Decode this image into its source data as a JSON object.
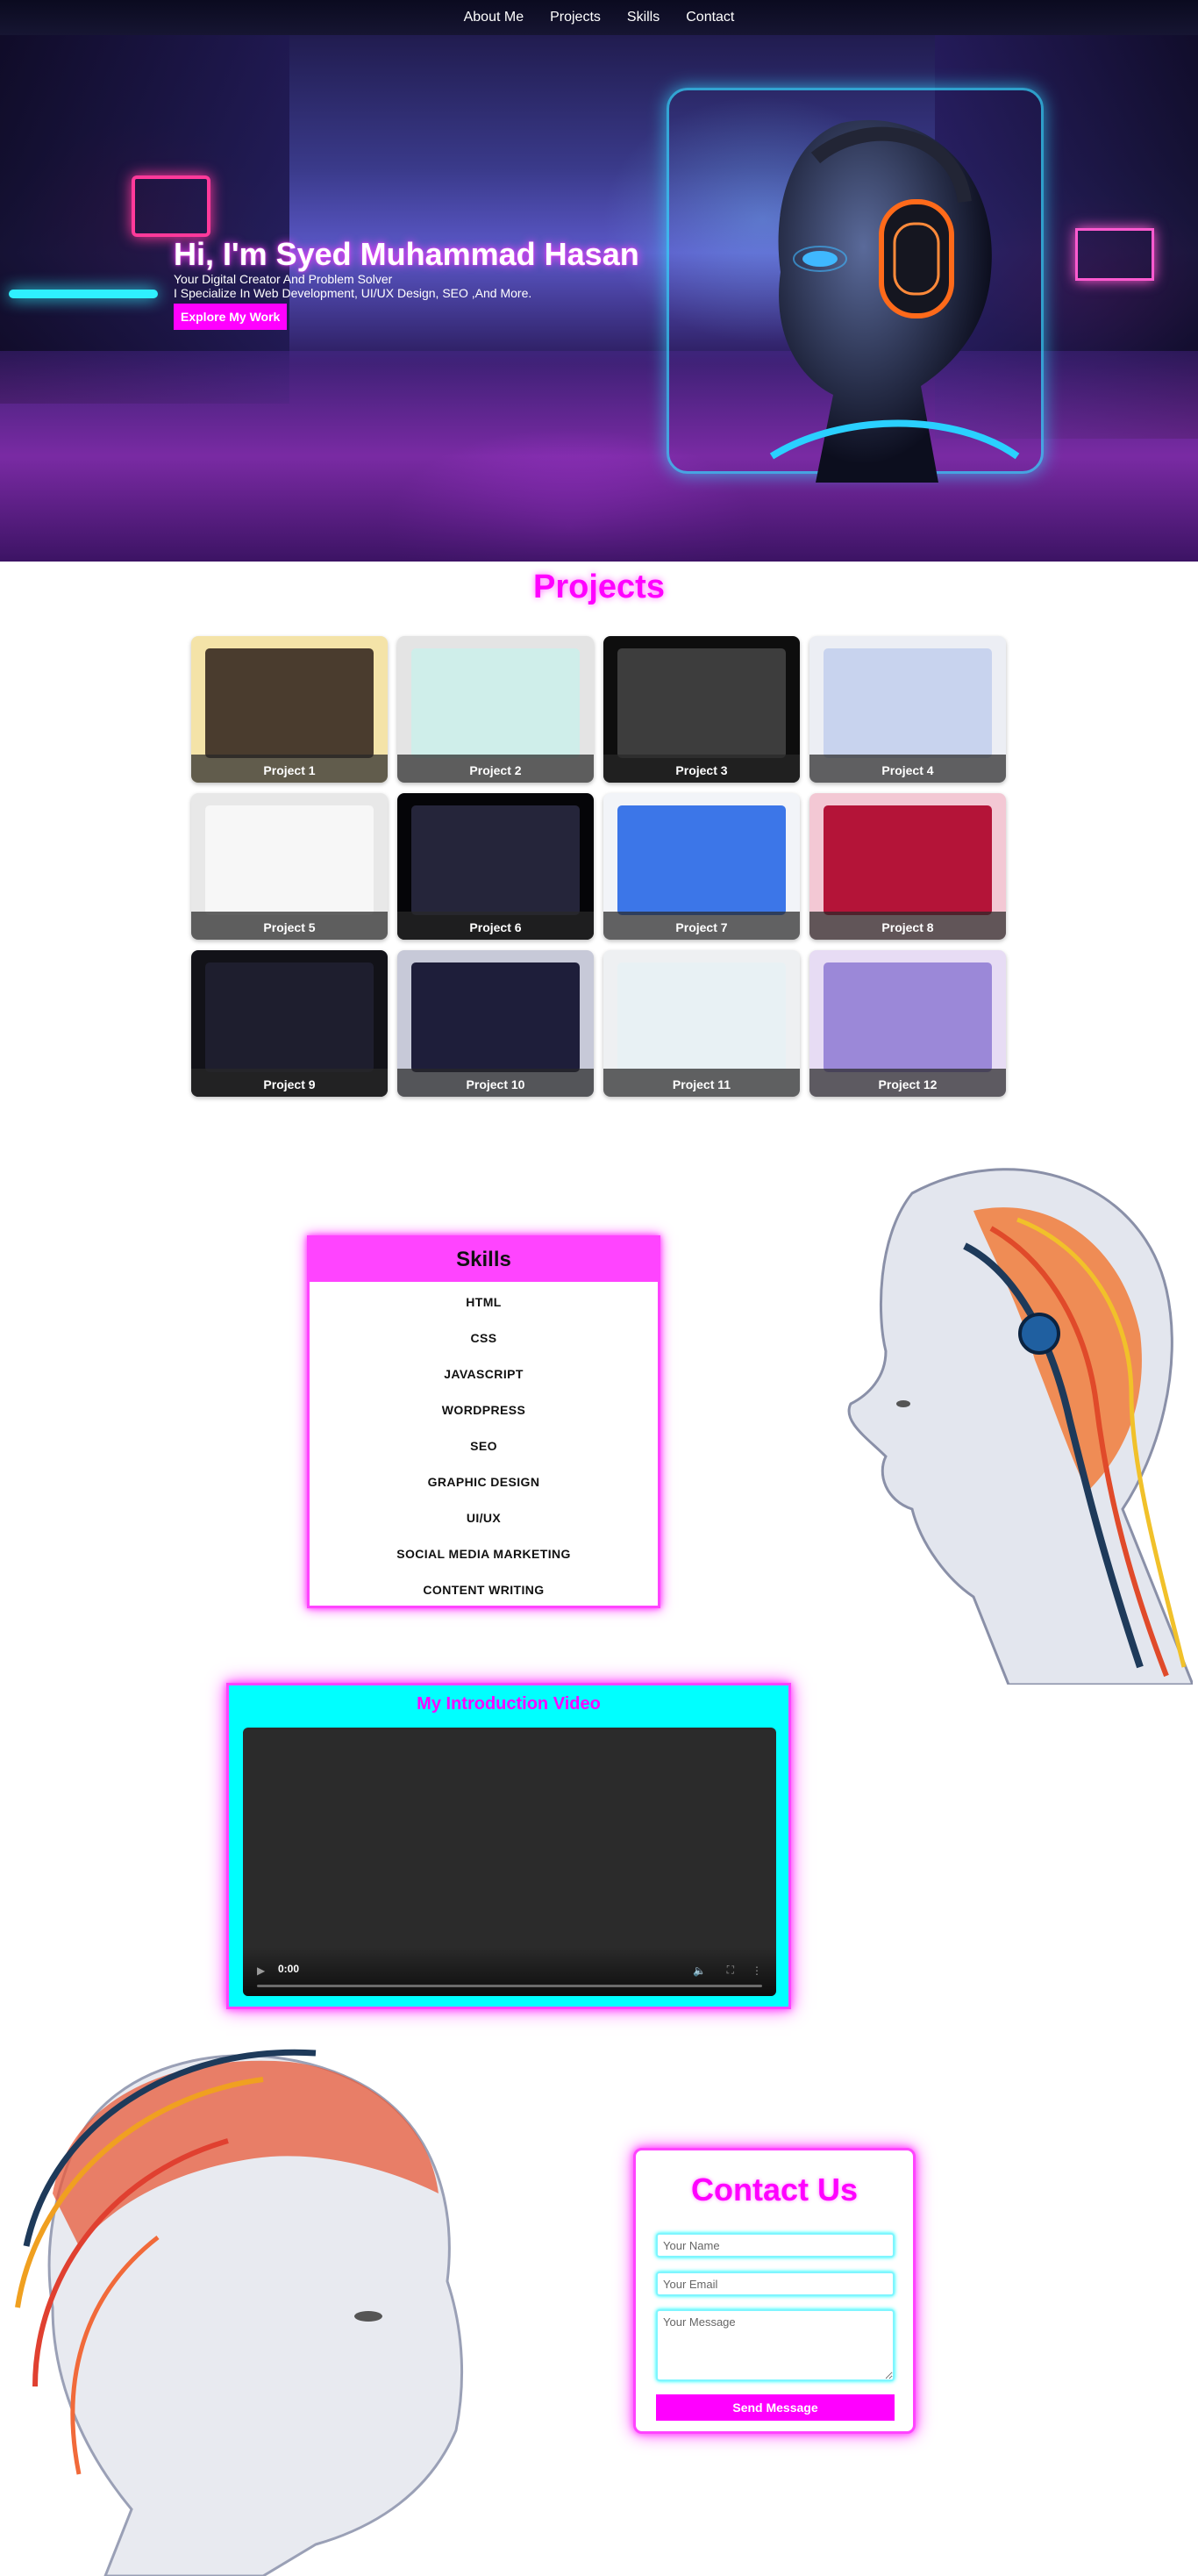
{
  "nav": {
    "items": [
      "About Me",
      "Projects",
      "Skills",
      "Contact"
    ]
  },
  "hero": {
    "title": "Hi, I'm Syed Muhammad Hasan",
    "subtitle_line1": "Your Digital Creator And Problem Solver",
    "subtitle_line2": "I Specialize In Web Development, UI/UX Design, SEO ,And More.",
    "cta_label": "Explore My Work"
  },
  "projects": {
    "title": "Projects",
    "items": [
      {
        "label": "Project 1",
        "bg": "#f4e3a8",
        "screen": "#4a3c2e"
      },
      {
        "label": "Project 2",
        "bg": "#e4e4e4",
        "screen": "#cfeeea"
      },
      {
        "label": "Project 3",
        "bg": "#0e0e0e",
        "screen": "#3d3d3d"
      },
      {
        "label": "Project 4",
        "bg": "#eceef4",
        "screen": "#c8d3ee"
      },
      {
        "label": "Project 5",
        "bg": "#e8e8e8",
        "screen": "#f7f7f7"
      },
      {
        "label": "Project 6",
        "bg": "#050508",
        "screen": "#25253a"
      },
      {
        "label": "Project 7",
        "bg": "#f2f4f8",
        "screen": "#3c76e8"
      },
      {
        "label": "Project 8",
        "bg": "#f3c8d4",
        "screen": "#b41438"
      },
      {
        "label": "Project 9",
        "bg": "#121218",
        "screen": "#1e1e2e"
      },
      {
        "label": "Project 10",
        "bg": "#c7c9d8",
        "screen": "#1e1e3a"
      },
      {
        "label": "Project 11",
        "bg": "#eef0f2",
        "screen": "#e8f1f4"
      },
      {
        "label": "Project 12",
        "bg": "#e7dcf4",
        "screen": "#9b88d8"
      }
    ]
  },
  "skills": {
    "title": "Skills",
    "items": [
      "HTML",
      "CSS",
      "JAVASCRIPT",
      "WORDPRESS",
      "SEO",
      "GRAPHIC DESIGN",
      "UI/UX",
      "SOCIAL MEDIA MARKETING",
      "CONTENT WRITING"
    ]
  },
  "video": {
    "title": "My Introduction Video",
    "time": "0:00"
  },
  "contact": {
    "title": "Contact Us",
    "name_placeholder": "Your Name",
    "email_placeholder": "Your Email",
    "message_placeholder": "Your Message",
    "send_label": "Send Message"
  },
  "colors": {
    "accent": "#ff00ff",
    "glow": "#ff44ff",
    "cyan": "#00ffff"
  }
}
